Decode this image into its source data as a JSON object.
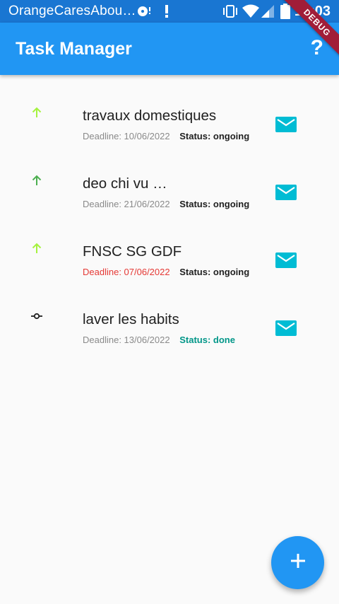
{
  "status_bar": {
    "carrier": "OrangeCaresAbou…",
    "time": "12:03"
  },
  "app_bar": {
    "title": "Task Manager",
    "help_label": "?"
  },
  "debug_banner": "DEBUG",
  "tasks": [
    {
      "title": "travaux domestiques",
      "deadline": "Deadline: 10/06/2022",
      "status": "Status: ongoing",
      "priority_icon": "arrow-up-icon",
      "icon_color": "#a5f23e"
    },
    {
      "title": "deo chi vu …",
      "deadline": "Deadline: 21/06/2022",
      "status": "Status: ongoing",
      "priority_icon": "arrow-up-icon",
      "icon_color": "#4caf50"
    },
    {
      "title": "FNSC SG GDF",
      "deadline": "Deadline: 07/06/2022",
      "status": "Status: ongoing",
      "priority_icon": "arrow-up-icon",
      "icon_color": "#a5f23e"
    },
    {
      "title": "laver les habits",
      "deadline": "Deadline: 13/06/2022",
      "status": "Status: done",
      "priority_icon": "commit-icon",
      "icon_color": "#212121"
    }
  ],
  "icons": {
    "mail": "mail-icon",
    "fab": "add-icon"
  },
  "colors": {
    "primary": "#2196f3",
    "status_bar": "#1976d2",
    "mail_icon": "#00bcd4",
    "overdue": "#e53935",
    "done": "#009688"
  }
}
